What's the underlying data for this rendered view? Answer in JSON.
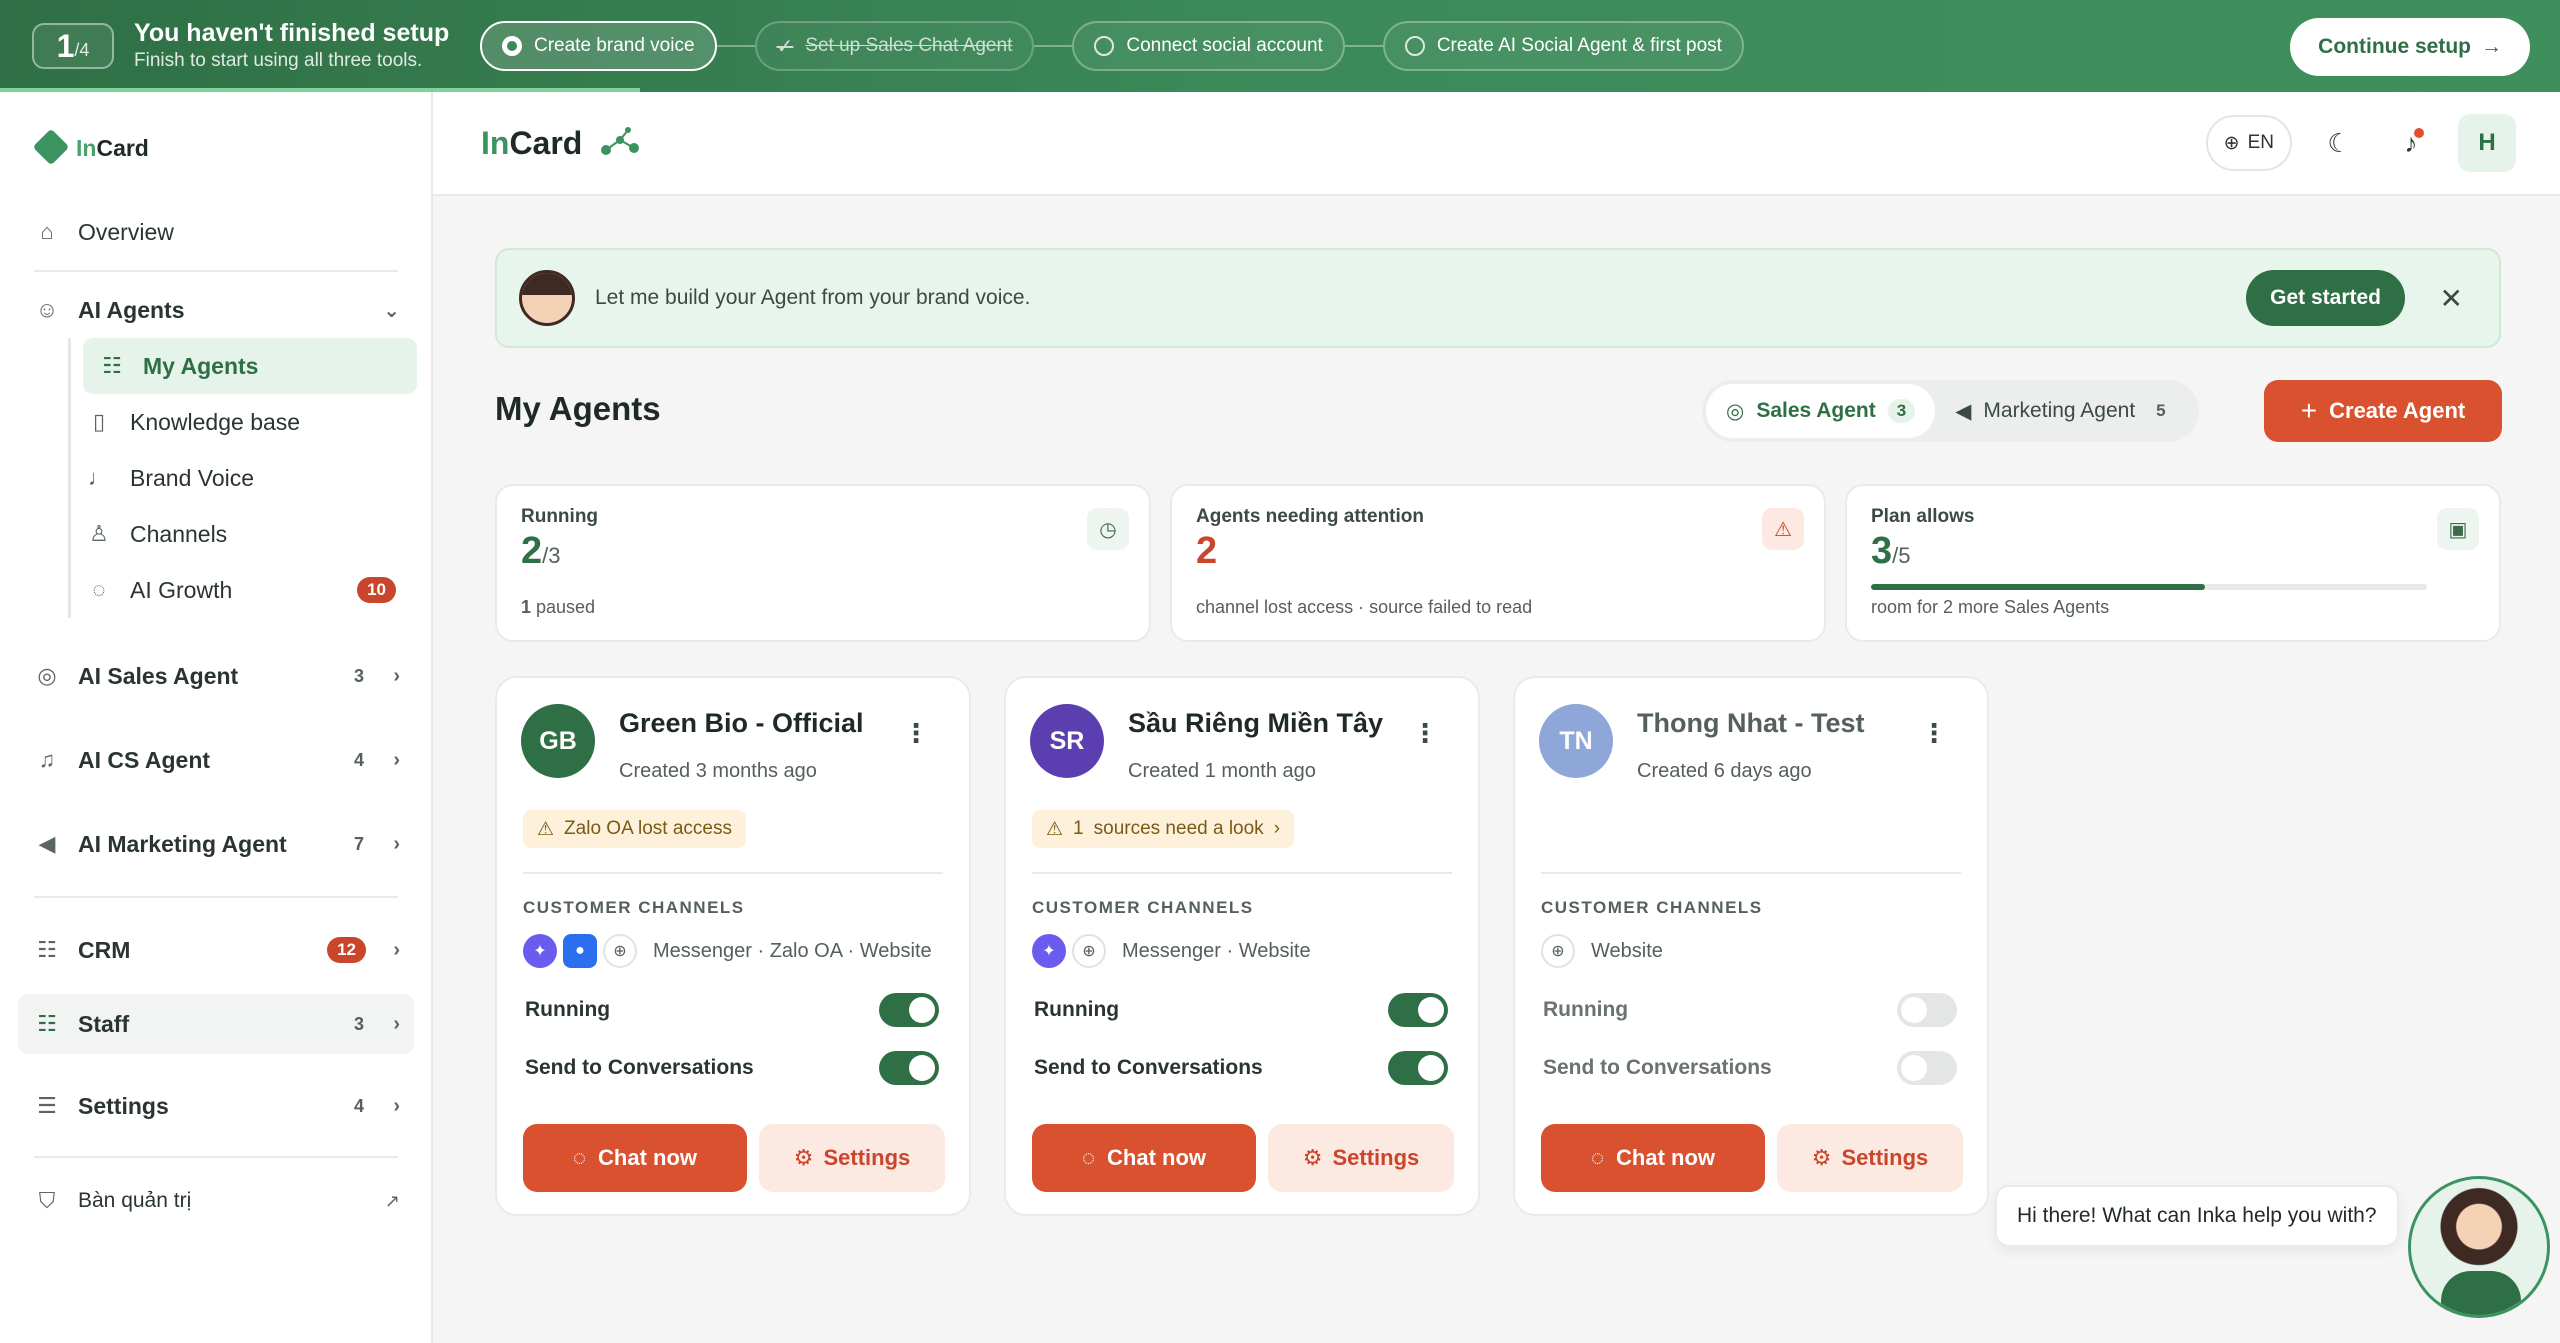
{
  "setup": {
    "step_current": "1",
    "step_total": "/4",
    "title": "You haven't finished setup",
    "subtitle": "Finish to start using all three tools.",
    "steps": [
      {
        "label": "Create brand voice",
        "state": "active"
      },
      {
        "label": "Set up Sales Chat Agent",
        "state": "done"
      },
      {
        "label": "Connect social account",
        "state": "todo"
      },
      {
        "label": "Create AI Social Agent & first post",
        "state": "todo"
      }
    ],
    "continue_label": "Continue setup",
    "progress_fraction": 0.25
  },
  "sidebar": {
    "logo_text_in": "In",
    "logo_text_card": "Card",
    "overview": "Overview",
    "ai_agents": "AI Agents",
    "sub_items": [
      {
        "label": "My Agents",
        "icon": "users-icon"
      },
      {
        "label": "Knowledge base",
        "icon": "book-icon"
      },
      {
        "label": "Brand Voice",
        "icon": "mic-icon"
      },
      {
        "label": "Channels",
        "icon": "user-icon"
      },
      {
        "label": "AI Growth",
        "icon": "chat-icon",
        "badge": "10"
      }
    ],
    "ai_sales_agent": {
      "label": "AI Sales Agent",
      "count": "3"
    },
    "ai_cs_agent": {
      "label": "AI CS Agent",
      "count": "4"
    },
    "ai_marketing_agent": {
      "label": "AI Marketing Agent",
      "count": "7"
    },
    "crm": {
      "label": "CRM",
      "badge": "12"
    },
    "staff": {
      "label": "Staff",
      "count": "3"
    },
    "settings": {
      "label": "Settings",
      "count": "4"
    },
    "admin": "Bàn quản trị"
  },
  "header": {
    "brand_in": "In",
    "brand_card": "Card",
    "lang": "EN",
    "avatar": "H"
  },
  "banner": {
    "text": "Let me build your Agent from your brand voice.",
    "cta": "Get started"
  },
  "main": {
    "title": "My Agents",
    "tabs": [
      {
        "label": "Sales Agent",
        "count": "3"
      },
      {
        "label": "Marketing Agent",
        "count": "5"
      }
    ],
    "create_label": "Create Agent"
  },
  "stats": {
    "running": {
      "label": "Running",
      "value": "2",
      "total": "/3",
      "foot_num": "1",
      "foot": " paused"
    },
    "attention": {
      "label": "Agents needing attention",
      "value": "2",
      "foot": "channel lost access · source failed to read"
    },
    "plan": {
      "label": "Plan allows",
      "value": "3",
      "total": "/5",
      "foot": "room for 2 more Sales Agents",
      "fraction": 0.6
    }
  },
  "agents": [
    {
      "initials": "GB",
      "name": "Green Bio - Official",
      "created": "Created 3 months ago",
      "avatar_color": "#2f6f45",
      "warning": "Zalo OA lost access",
      "channels_header": "CUSTOMER CHANNELS",
      "channels": "Messenger · Zalo OA · Website",
      "running_label": "Running",
      "running": true,
      "send_label": "Send to Conversations",
      "send": true,
      "chat_label": "Chat now",
      "settings_label": "Settings"
    },
    {
      "initials": "SR",
      "name": "Sầu Riêng Miền Tây",
      "created": "Created 1 month ago",
      "avatar_color": "#5b3fb0",
      "warning_count": "1",
      "warning": "sources need a look",
      "channels_header": "CUSTOMER CHANNELS",
      "channels": "Messenger · Website",
      "running_label": "Running",
      "running": true,
      "send_label": "Send to Conversations",
      "send": true,
      "chat_label": "Chat now",
      "settings_label": "Settings"
    },
    {
      "initials": "TN",
      "name": "Thong Nhat - Test",
      "created": "Created 6 days ago",
      "avatar_color": "#8fa6d8",
      "channels_header": "CUSTOMER CHANNELS",
      "channels": "Website",
      "running_label": "Running",
      "running": false,
      "send_label": "Send to Conversations",
      "send": false,
      "chat_label": "Chat now",
      "settings_label": "Settings"
    }
  ],
  "helper": {
    "text": "Hi there! What can Inka help you with?"
  }
}
